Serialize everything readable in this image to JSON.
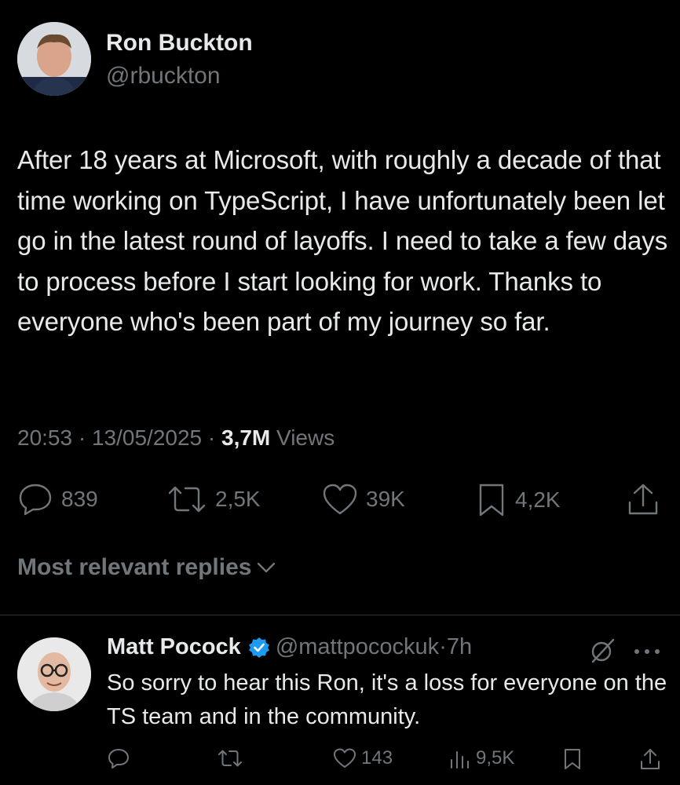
{
  "tweet": {
    "author_name": "Ron Buckton",
    "author_handle": "@rbuckton",
    "text": "After 18 years at Microsoft, with roughly a decade of that time working on TypeScript, I have unfortunately been let go in the latest round of layoffs. I need to take a few days to process before I start looking for work. Thanks to everyone who's been part of my journey so far.",
    "time": "20:53",
    "date": "13/05/2025",
    "views_count": "3,7M",
    "views_label": "Views",
    "replies": "839",
    "reposts": "2,5K",
    "likes": "39K",
    "bookmarks": "4,2K"
  },
  "replies_filter": {
    "label": "Most relevant replies"
  },
  "reply": {
    "author_name": "Matt Pocock",
    "author_handle": "@mattpocockuk",
    "age": "7h",
    "text": "So sorry to hear this Ron, it's a loss for everyone on the TS team and in the community.",
    "likes": "143",
    "views": "9,5K"
  },
  "colors": {
    "background": "#000000",
    "text": "#e7e9ea",
    "muted": "#71767b",
    "verified": "#1d9bf0"
  }
}
